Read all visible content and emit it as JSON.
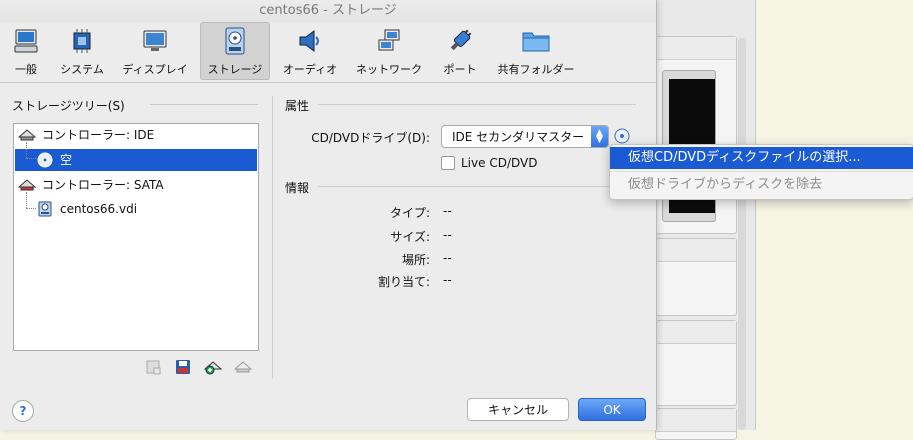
{
  "window": {
    "title": "centos66 - ストレージ"
  },
  "toolbar": {
    "items": [
      {
        "label": "一般",
        "icon": "general-icon"
      },
      {
        "label": "システム",
        "icon": "system-chip-icon"
      },
      {
        "label": "ディスプレイ",
        "icon": "display-monitor-icon"
      },
      {
        "label": "ストレージ",
        "icon": "storage-disk-icon"
      },
      {
        "label": "オーディオ",
        "icon": "speaker-icon"
      },
      {
        "label": "ネットワーク",
        "icon": "network-icon"
      },
      {
        "label": "ポート",
        "icon": "serial-port-plug-icon"
      },
      {
        "label": "共有フォルダー",
        "icon": "shared-folder-icon"
      }
    ],
    "active_index": 3
  },
  "storage_tree": {
    "title": "ストレージツリー(S)",
    "nodes": [
      {
        "label": "コントローラー: IDE",
        "icon": "ide-controller-icon"
      },
      {
        "label": "空",
        "icon": "optical-disc-icon",
        "selected": true
      },
      {
        "label": "コントローラー: SATA",
        "icon": "sata-controller-icon"
      },
      {
        "label": "centos66.vdi",
        "icon": "hard-disk-icon"
      }
    ],
    "actions": [
      {
        "icon": "add-attachment-disabled-icon"
      },
      {
        "icon": "save-disk-icon"
      },
      {
        "icon": "add-controller-icon"
      },
      {
        "icon": "remove-controller-icon"
      }
    ]
  },
  "attributes": {
    "title": "属性",
    "cd_drive_label": "CD/DVDドライブ(D):",
    "cd_drive_value": "IDE セカンダリマスター",
    "live_cd_label": "Live CD/DVD"
  },
  "info": {
    "title": "情報",
    "rows": [
      {
        "label": "タイプ:",
        "value": "--"
      },
      {
        "label": "サイズ:",
        "value": "--"
      },
      {
        "label": "場所:",
        "value": "--"
      },
      {
        "label": "割り当て:",
        "value": "--"
      }
    ]
  },
  "popup_menu": {
    "items": [
      {
        "label": "仮想CD/DVDディスクファイルの選択...",
        "highlighted": true
      },
      {
        "label": "仮想ドライブからディスクを除去",
        "disabled": true
      }
    ]
  },
  "buttons": {
    "cancel": "キャンセル",
    "ok": "OK",
    "help": "?"
  },
  "colors": {
    "selection": "#1a5ad2",
    "primary_button": "#2d6ee0"
  }
}
